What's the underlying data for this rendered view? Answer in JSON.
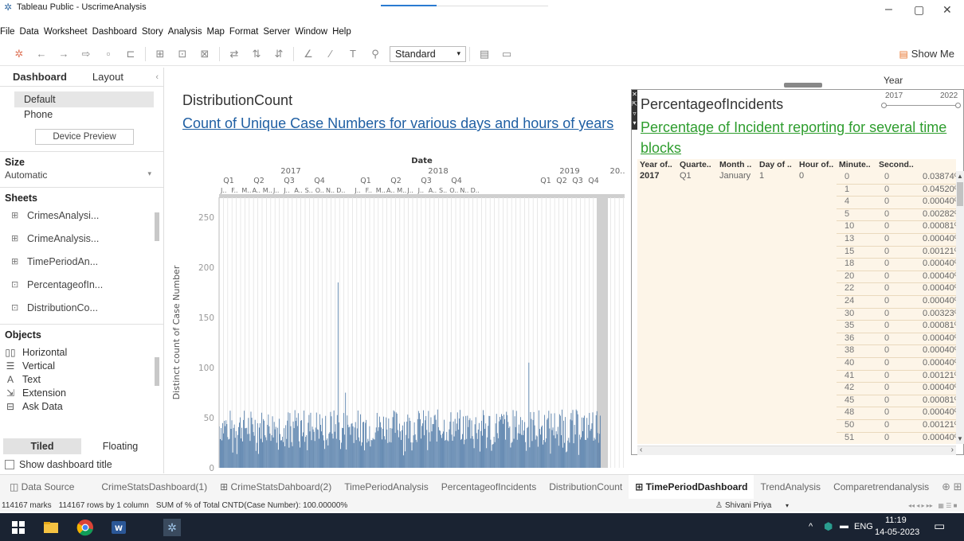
{
  "window": {
    "title": "Tableau Public - UscrimeAnalysis",
    "minimize": "–",
    "maximize": "▢",
    "close": "✕"
  },
  "menu": [
    "File",
    "Data",
    "Worksheet",
    "Dashboard",
    "Story",
    "Analysis",
    "Map",
    "Format",
    "Server",
    "Window",
    "Help"
  ],
  "toolbar": {
    "fit_value": "Standard",
    "show_me": "Show Me"
  },
  "left_panel": {
    "tabs": [
      "Dashboard",
      "Layout"
    ],
    "devices": [
      "Default",
      "Phone"
    ],
    "device_preview": "Device Preview",
    "size_heading": "Size",
    "size_value": "Automatic",
    "sheets_heading": "Sheets",
    "sheets": [
      "CrimesAnalysi...",
      "CrimeAnalysis...",
      "TimePeriodAn...",
      "PercentageofIn...",
      "DistributionCo..."
    ],
    "objects_heading": "Objects",
    "objects": [
      "Horizontal",
      "Vertical",
      "Text",
      "Extension",
      "Ask Data"
    ],
    "tiled": "Tiled",
    "floating": "Floating",
    "show_title": "Show dashboard title"
  },
  "distribution": {
    "title": "DistributionCount",
    "subtitle": "Count of Unique Case Numbers for various days and hours of years"
  },
  "chart_data": {
    "type": "bar",
    "ylabel": "Distinct count of Case Number",
    "xlabel": "Date",
    "ylim": [
      0,
      270
    ],
    "yticks": [
      0,
      50,
      100,
      150,
      200,
      250
    ],
    "years": [
      "2017",
      "2018",
      "2019",
      "20.."
    ],
    "quarters": [
      "Q1",
      "Q2",
      "Q3",
      "Q4",
      "Q1",
      "Q2",
      "Q3",
      "Q4",
      "Q1",
      "Q2",
      "Q3",
      "Q4"
    ],
    "months": [
      "J..",
      "F..",
      "M..",
      "A..",
      "M..",
      "J..",
      "J..",
      "A..",
      "S..",
      "O..",
      "N..",
      "D..",
      "J..",
      "F..",
      "M..",
      "A..",
      "M..",
      "J..",
      "J..",
      "A..",
      "S..",
      "O..",
      "N..",
      "D.."
    ],
    "base_level": 45,
    "spikes": [
      {
        "position": 0.31,
        "value": 185
      },
      {
        "position": 0.33,
        "value": 75
      },
      {
        "position": 0.81,
        "value": 105
      }
    ]
  },
  "percentage": {
    "title": "PercentageofIncidents",
    "subtitle": "Percentage of Incident reporting for several time blocks",
    "headers": [
      "Year of..",
      "Quarte..",
      "Month ..",
      "Day of ..",
      "Hour of..",
      "Minute..",
      "Second.."
    ],
    "first_row": {
      "year": "2017",
      "quarter": "Q1",
      "month": "January",
      "day": "1",
      "hour": "0"
    },
    "rows": [
      {
        "minute": "0",
        "second": "0",
        "value": "0.03874%"
      },
      {
        "minute": "1",
        "second": "0",
        "value": "0.04520%"
      },
      {
        "minute": "4",
        "second": "0",
        "value": "0.00040%"
      },
      {
        "minute": "5",
        "second": "0",
        "value": "0.00282%"
      },
      {
        "minute": "10",
        "second": "0",
        "value": "0.00081%"
      },
      {
        "minute": "13",
        "second": "0",
        "value": "0.00040%"
      },
      {
        "minute": "15",
        "second": "0",
        "value": "0.00121%"
      },
      {
        "minute": "18",
        "second": "0",
        "value": "0.00040%"
      },
      {
        "minute": "20",
        "second": "0",
        "value": "0.00040%"
      },
      {
        "minute": "22",
        "second": "0",
        "value": "0.00040%"
      },
      {
        "minute": "24",
        "second": "0",
        "value": "0.00040%"
      },
      {
        "minute": "30",
        "second": "0",
        "value": "0.00323%"
      },
      {
        "minute": "35",
        "second": "0",
        "value": "0.00081%"
      },
      {
        "minute": "36",
        "second": "0",
        "value": "0.00040%"
      },
      {
        "minute": "38",
        "second": "0",
        "value": "0.00040%"
      },
      {
        "minute": "40",
        "second": "0",
        "value": "0.00040%"
      },
      {
        "minute": "41",
        "second": "0",
        "value": "0.00121%"
      },
      {
        "minute": "42",
        "second": "0",
        "value": "0.00040%"
      },
      {
        "minute": "45",
        "second": "0",
        "value": "0.00081%"
      },
      {
        "minute": "48",
        "second": "0",
        "value": "0.00040%"
      },
      {
        "minute": "50",
        "second": "0",
        "value": "0.00121%"
      },
      {
        "minute": "51",
        "second": "0",
        "value": "0.00040%"
      }
    ]
  },
  "year_filter": {
    "label": "Year",
    "min": "2017",
    "max": "2022"
  },
  "sheet_tabs": [
    "Data Source",
    "CrimeStatsDashboard(1)",
    "CrimeStatsDahboard(2)",
    "TimePeriodAnalysis",
    "PercentageofIncidents",
    "DistributionCount",
    "TimePeriodDashboard",
    "TrendAnalysis",
    "Comparetrendanalysis"
  ],
  "active_tab": "TimePeriodDashboard",
  "status": {
    "marks": "114167 marks",
    "rows": "114167 rows by 1 column",
    "sum": "SUM of % of Total CNTD(Case Number): 100.00000%",
    "user": "Shivani Priya"
  },
  "taskbar": {
    "lang": "ENG",
    "time": "11:19",
    "date": "14-05-2023"
  },
  "colors": {
    "bar": "#4e79a7",
    "link_blue": "#1f5fa3",
    "link_green": "#2e9d2e",
    "table_bg": "#fdf5e8"
  }
}
